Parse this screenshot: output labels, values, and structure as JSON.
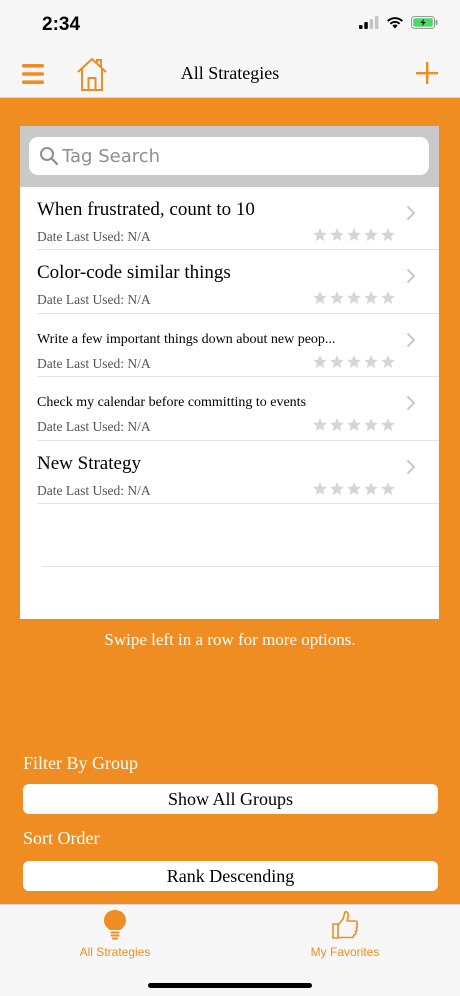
{
  "status_bar": {
    "time": "2:34"
  },
  "nav": {
    "title": "All Strategies"
  },
  "search": {
    "placeholder": "Tag Search",
    "value": ""
  },
  "strategies": [
    {
      "title": "When frustrated, count to 10",
      "date": "Date Last Used: N/A",
      "rating": 0
    },
    {
      "title": "Color-code similar things",
      "date": "Date Last Used: N/A",
      "rating": 0
    },
    {
      "title": "Write a few important things down about new peop...",
      "date": "Date Last Used: N/A",
      "rating": 0
    },
    {
      "title": "Check my calendar before committing to events",
      "date": "Date Last Used: N/A",
      "rating": 0
    },
    {
      "title": "New Strategy",
      "date": "Date Last Used: N/A",
      "rating": 0
    }
  ],
  "hint": "Swipe left in a row for more options.",
  "filter": {
    "label": "Filter By Group",
    "value": "Show All Groups"
  },
  "sort": {
    "label": "Sort Order",
    "value": "Rank Descending"
  },
  "tabs": [
    {
      "label": "All Strategies",
      "icon": "lightbulb-icon"
    },
    {
      "label": "My Favorites",
      "icon": "thumbs-up-icon"
    }
  ],
  "colors": {
    "accent": "#ef8d22",
    "bar": "#f7f7f7",
    "star_empty": "#d5d5d5",
    "battery": "#4cd964"
  }
}
